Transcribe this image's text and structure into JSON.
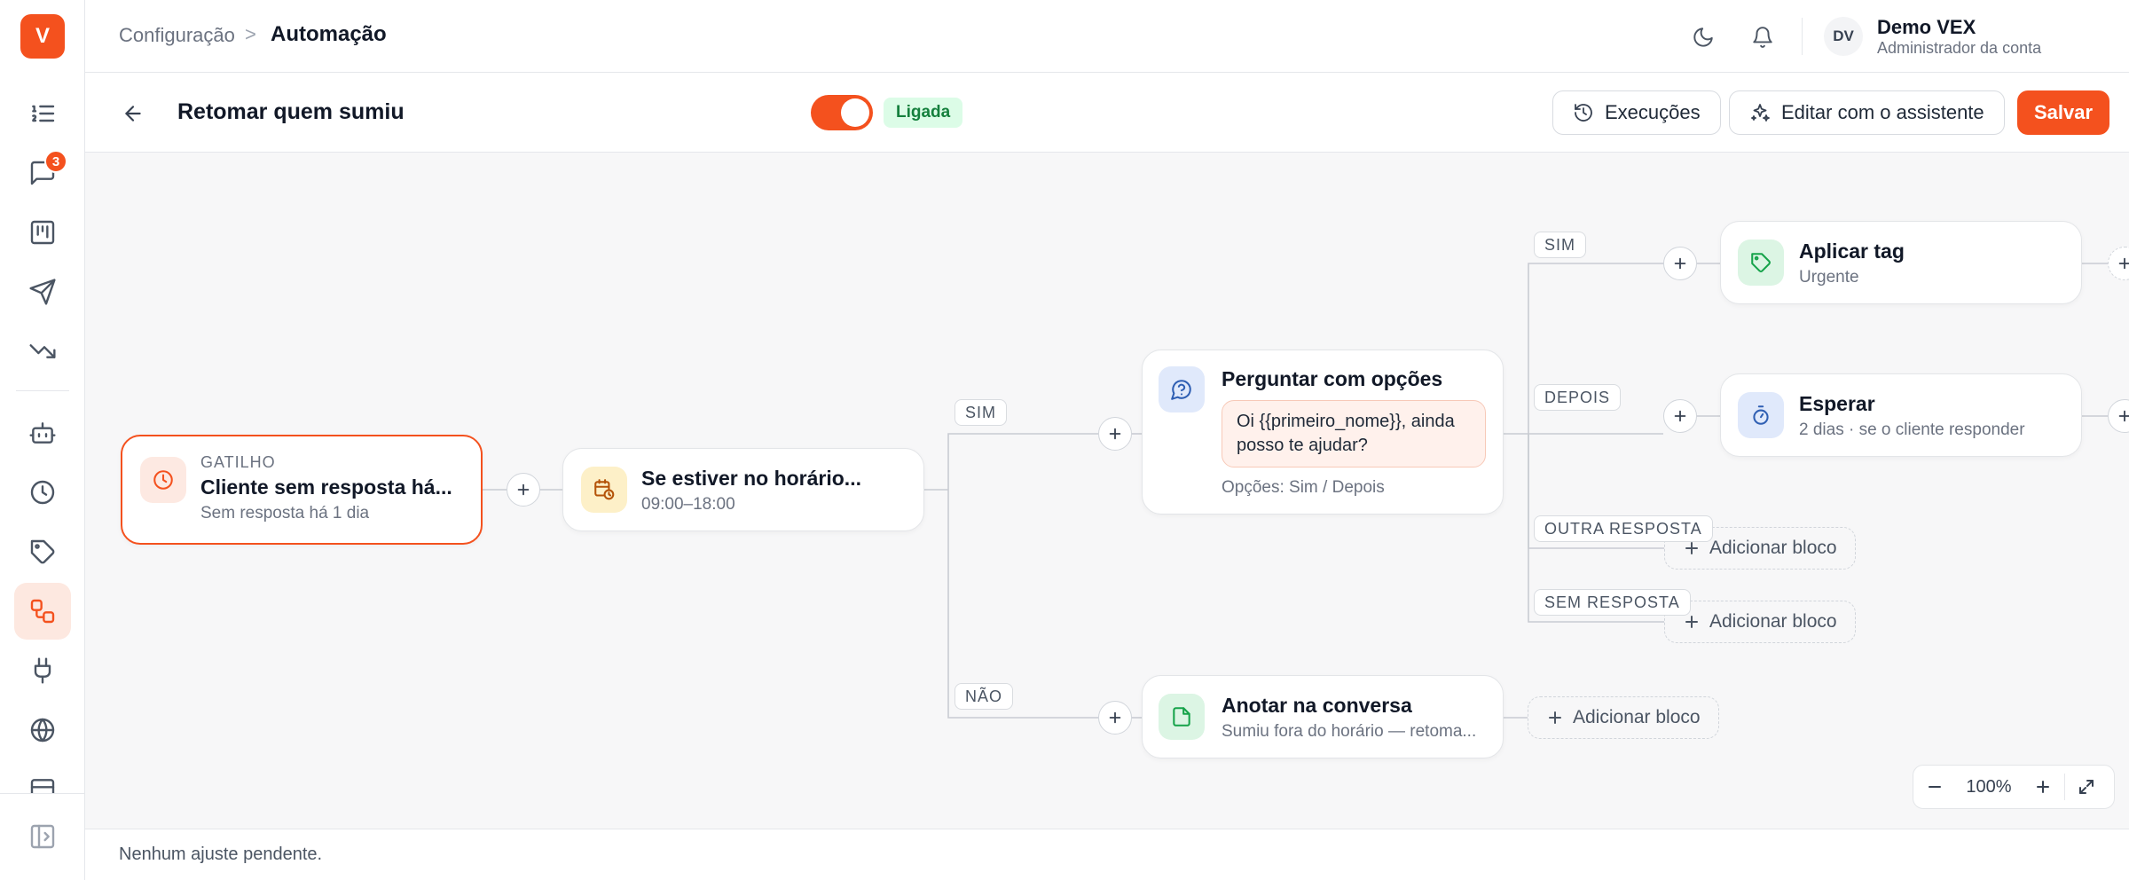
{
  "app": {
    "logo_letter": "V"
  },
  "sidebar": {
    "items": [
      {
        "name": "sidebar-item-list",
        "icon": "list-ordered-icon"
      },
      {
        "name": "sidebar-item-conversations",
        "icon": "chat-icon",
        "badge": "3"
      },
      {
        "name": "sidebar-item-board",
        "icon": "kanban-icon"
      },
      {
        "name": "sidebar-item-campaigns",
        "icon": "send-icon"
      },
      {
        "name": "sidebar-item-reports",
        "icon": "trend-down-icon"
      },
      {
        "name": "sidebar-item-bots",
        "icon": "bot-icon"
      },
      {
        "name": "sidebar-item-history",
        "icon": "clock-icon"
      },
      {
        "name": "sidebar-item-tags",
        "icon": "tag-icon"
      },
      {
        "name": "sidebar-item-automation",
        "icon": "workflow-icon",
        "active": true
      },
      {
        "name": "sidebar-item-integrations",
        "icon": "plug-icon"
      },
      {
        "name": "sidebar-item-web",
        "icon": "globe-icon"
      }
    ]
  },
  "header": {
    "breadcrumb_parent": "Configuração",
    "breadcrumb_separator": ">",
    "breadcrumb_current": "Automação",
    "user": {
      "initials": "DV",
      "name": "Demo VEX",
      "role": "Administrador da conta"
    }
  },
  "flow": {
    "title": "Retomar quem sumiu",
    "status_label": "Ligada",
    "buttons": {
      "executions": "Execuções",
      "edit_assistant": "Editar com o assistente",
      "save": "Salvar"
    }
  },
  "canvas": {
    "nodes": {
      "trigger": {
        "kicker": "GATILHO",
        "title": "Cliente sem resposta há...",
        "sub": "Sem resposta há 1 dia"
      },
      "condition": {
        "title": "Se estiver no horário...",
        "sub": "09:00–18:00"
      },
      "ask": {
        "title": "Perguntar com opções",
        "message": "Oi {{primeiro_nome}}, ainda posso te ajudar?",
        "options": "Opções: Sim / Depois"
      },
      "tag": {
        "title": "Aplicar tag",
        "sub": "Urgente"
      },
      "wait": {
        "title": "Esperar",
        "sub": "2 dias · se o cliente responder"
      },
      "note": {
        "title": "Anotar na conversa",
        "sub": "Sumiu fora do horário — retoma..."
      }
    },
    "edge_labels": {
      "yes_1": "SIM",
      "no_1": "NÃO",
      "yes_2": "SIM",
      "later": "DEPOIS",
      "other": "OUTRA RESPOSTA",
      "none": "SEM RESPOSTA"
    },
    "add_block_label": "Adicionar bloco",
    "zoom": "100%"
  },
  "footer": {
    "status": "Nenhum ajuste pendente."
  },
  "colors": {
    "accent": "#f4511e",
    "success_bg": "#dcfce7",
    "success_text": "#15803d"
  }
}
